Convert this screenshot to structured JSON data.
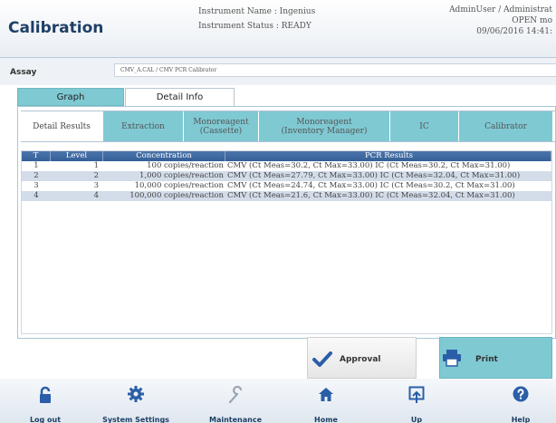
{
  "header": {
    "title": "Calibration",
    "instrument_name": "Instrument Name : Ingenius",
    "instrument_status": "Instrument Status : READY",
    "user": "AdminUser / Administrat",
    "mode": "OPEN mo",
    "datetime": "09/06/2016 14:41:"
  },
  "assay": {
    "label": "Assay",
    "value": "CMV_A.CAL / CMV PCR Calibrator"
  },
  "main_tabs": [
    {
      "label": "Graph"
    },
    {
      "label": "Detail Info"
    }
  ],
  "sub_tabs": [
    {
      "label": "Detail Results"
    },
    {
      "label": "Extraction"
    },
    {
      "label": "Monoreagent\n(Cassette)"
    },
    {
      "label": "Monoreagent\n(Inventory Manager)"
    },
    {
      "label": "IC"
    },
    {
      "label": "Calibrator"
    }
  ],
  "table": {
    "headers": [
      "T",
      "Level",
      "Concentration",
      "PCR Results"
    ],
    "rows": [
      [
        "1",
        "1",
        "100 copies/reaction",
        "CMV (Ct Meas=30.2, Ct Max=33.00) IC (Ct Meas=30.2, Ct Max=31.00)"
      ],
      [
        "2",
        "2",
        "1,000 copies/reaction",
        "CMV (Ct Meas=27.79, Ct Max=33.00) IC (Ct Meas=32.04, Ct Max=31.00)"
      ],
      [
        "3",
        "3",
        "10,000 copies/reaction",
        "CMV (Ct Meas=24.74, Ct Max=33.00) IC (Ct Meas=30.2, Ct Max=31.00)"
      ],
      [
        "4",
        "4",
        "100,000 copies/reaction",
        "CMV (Ct Meas=21.6, Ct Max=33.00) IC (Ct Meas=32.04, Ct Max=31.00)"
      ]
    ]
  },
  "actions": {
    "approval": "Approval",
    "print": "Print"
  },
  "footer": [
    {
      "label": "Log out",
      "icon": "lock-icon"
    },
    {
      "label": "System Settings",
      "icon": "gear-icon"
    },
    {
      "label": "Maintenance",
      "icon": "wrench-icon"
    },
    {
      "label": "Home",
      "icon": "home-icon"
    },
    {
      "label": "Up",
      "icon": "up-icon"
    },
    {
      "label": "Help",
      "icon": "help-icon"
    }
  ],
  "colors": {
    "accent": "#7fc9d3",
    "table_header": "#4c75ab",
    "title": "#1f3f66"
  }
}
